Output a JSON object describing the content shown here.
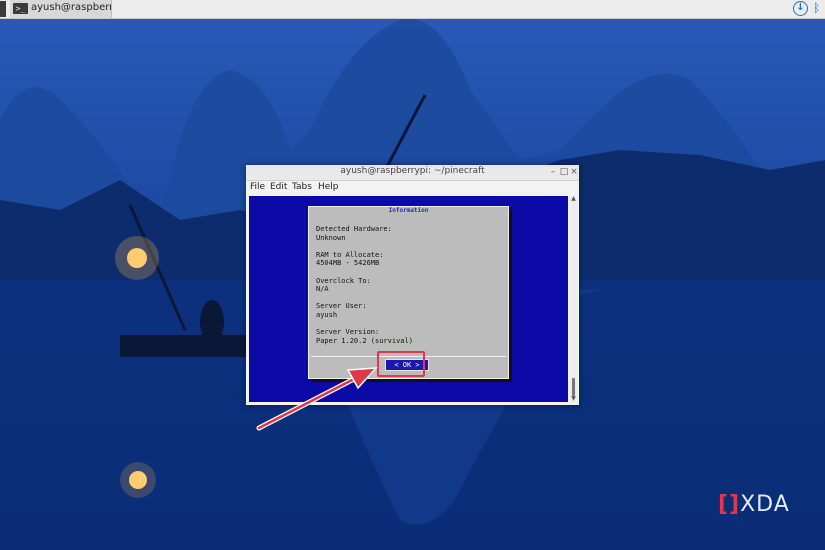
{
  "taskbar": {
    "task_label": "ayush@raspberrypi: ...",
    "terminal_icon_glyph": ">_"
  },
  "window": {
    "title": "ayush@raspberrypi: ~/pinecraft",
    "controls": {
      "minimize": "–",
      "maximize": "□",
      "close": "×"
    },
    "menu": [
      "File",
      "Edit",
      "Tabs",
      "Help"
    ]
  },
  "dialog": {
    "title": "Information",
    "lines": [
      "Detected Hardware:",
      "Unknown",
      "",
      "RAM to Allocate:",
      "4504MB - 5426MB",
      "",
      "Overclock To:",
      "N/A",
      "",
      "Server User:",
      "ayush",
      "",
      "Server Version:",
      "Paper 1.20.2 (survival)"
    ],
    "ok_label": "< OK >"
  },
  "watermark": {
    "mark": "[]",
    "text": "XDA"
  },
  "colors": {
    "terminal_bg": "#0c0aa6",
    "dialog_bg": "#bcbcbc",
    "accent_annotation": "#e0384a",
    "taskbar_icon": "#1976d2"
  }
}
